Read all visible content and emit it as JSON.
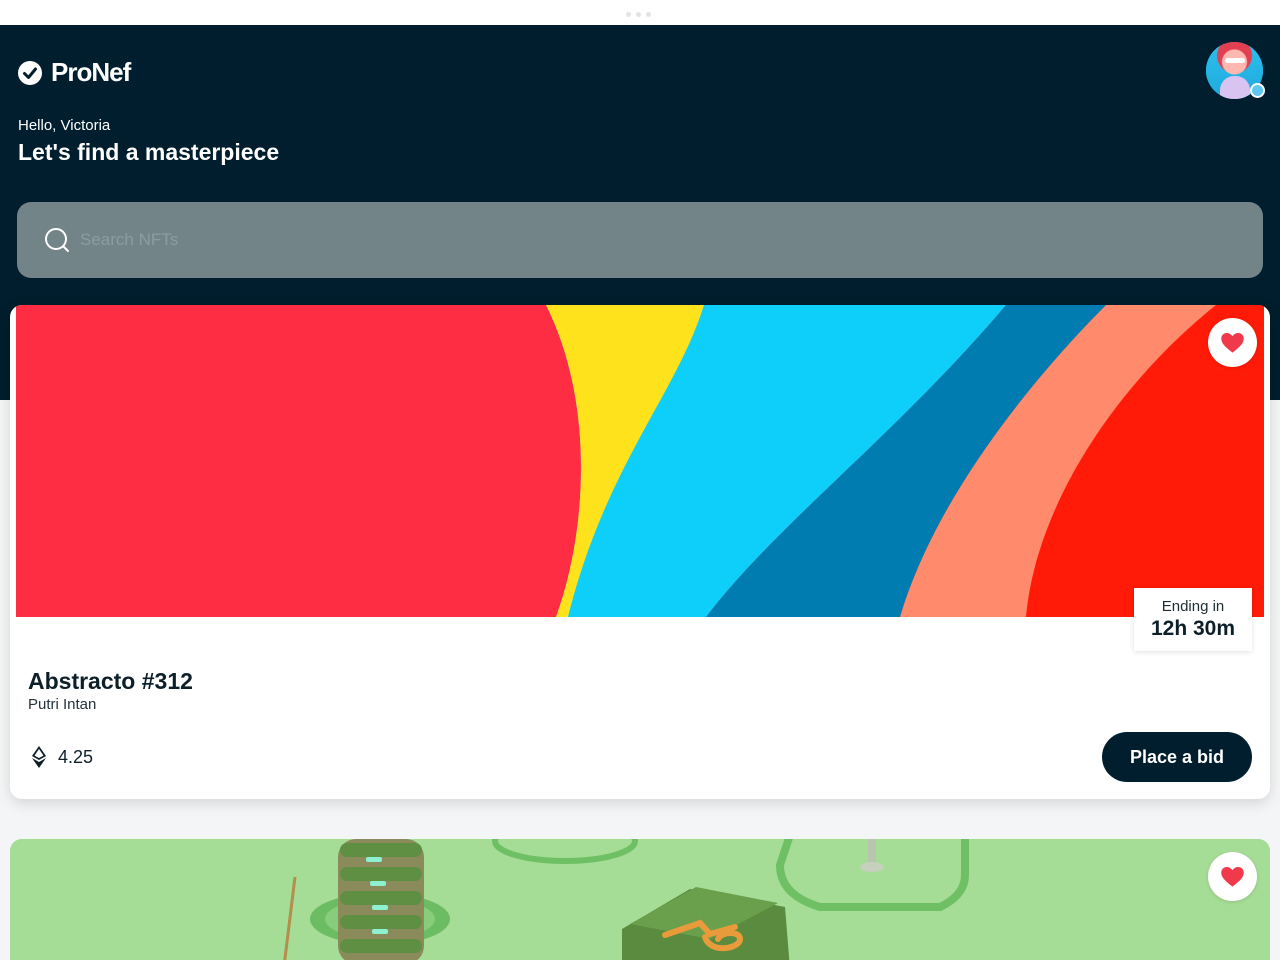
{
  "app": {
    "brand": "ProNef",
    "greeting": "Hello, Victoria",
    "headline": "Let's find a masterpiece"
  },
  "search": {
    "placeholder": "Search NFTs",
    "value": ""
  },
  "icons": {
    "logo": "check-badge-icon",
    "search": "search-icon",
    "favorite": "heart-icon",
    "currency": "ethereum-icon",
    "verified": "verified-badge-icon"
  },
  "colors": {
    "header_bg": "#001e2d",
    "accent_red": "#f0394b",
    "search_bg": "#738489",
    "button_bg": "#001e2d"
  },
  "nfts": [
    {
      "title": "Abstracto #312",
      "artist": "Putri Intan",
      "price": "4.25",
      "ending_label": "Ending in",
      "ending_value": "12h 30m",
      "action_label": "Place a bid",
      "favorited": true
    },
    {
      "favorited": true
    }
  ]
}
